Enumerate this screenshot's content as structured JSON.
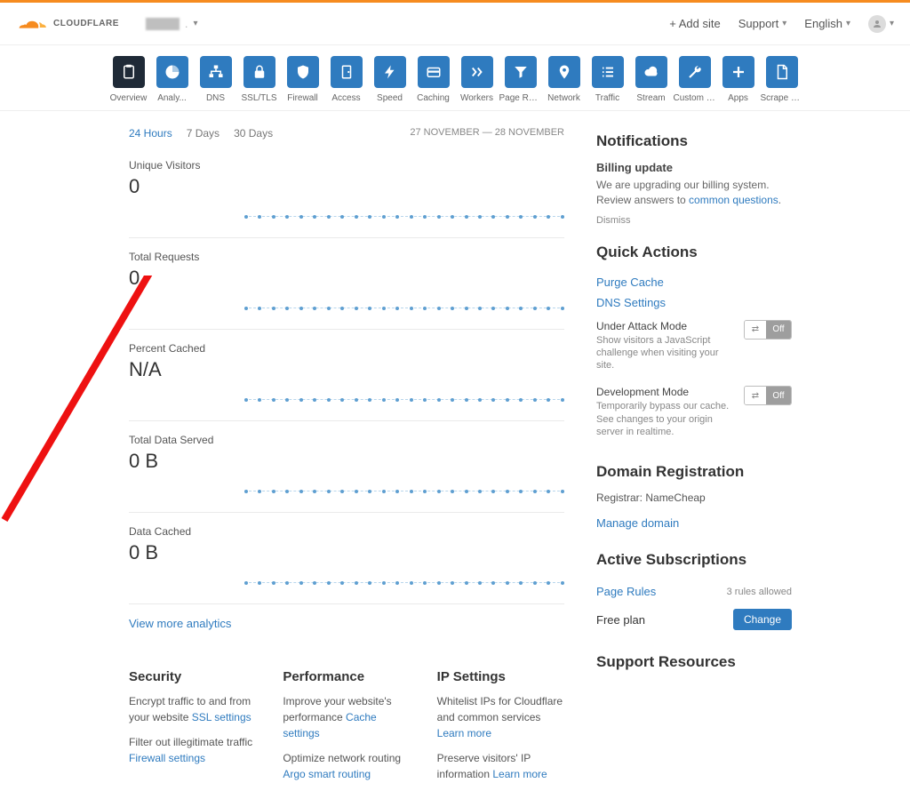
{
  "header": {
    "addSite": "+ Add site",
    "support": "Support",
    "language": "English"
  },
  "nav": [
    {
      "label": "Overview",
      "style": "dark",
      "icon": "clipboard"
    },
    {
      "label": "Analy...",
      "style": "blue",
      "icon": "pie"
    },
    {
      "label": "DNS",
      "style": "blue",
      "icon": "tree"
    },
    {
      "label": "SSL/TLS",
      "style": "blue",
      "icon": "lock"
    },
    {
      "label": "Firewall",
      "style": "blue",
      "icon": "shield"
    },
    {
      "label": "Access",
      "style": "blue",
      "icon": "door"
    },
    {
      "label": "Speed",
      "style": "blue",
      "icon": "bolt"
    },
    {
      "label": "Caching",
      "style": "blue",
      "icon": "card"
    },
    {
      "label": "Workers",
      "style": "blue",
      "icon": "chev"
    },
    {
      "label": "Page Rules",
      "style": "blue",
      "icon": "funnel"
    },
    {
      "label": "Network",
      "style": "blue",
      "icon": "pin"
    },
    {
      "label": "Traffic",
      "style": "blue",
      "icon": "list"
    },
    {
      "label": "Stream",
      "style": "blue",
      "icon": "cloud"
    },
    {
      "label": "Custom Pa...",
      "style": "blue",
      "icon": "wrench"
    },
    {
      "label": "Apps",
      "style": "blue",
      "icon": "plus"
    },
    {
      "label": "Scrape Shi...",
      "style": "blue",
      "icon": "file"
    }
  ],
  "tabs": [
    "24 Hours",
    "7 Days",
    "30 Days"
  ],
  "dateRange": "27 NOVEMBER — 28 NOVEMBER",
  "stats": [
    {
      "label": "Unique Visitors",
      "value": "0"
    },
    {
      "label": "Total Requests",
      "value": "0"
    },
    {
      "label": "Percent Cached",
      "value": "N/A"
    },
    {
      "label": "Total Data Served",
      "value": "0 B"
    },
    {
      "label": "Data Cached",
      "value": "0 B"
    }
  ],
  "viewMore": "View more analytics",
  "notifications": {
    "heading": "Notifications",
    "title": "Billing update",
    "body": "We are upgrading our billing system. Review answers to ",
    "link": "common questions",
    "dismiss": "Dismiss"
  },
  "quickActions": {
    "heading": "Quick Actions",
    "links": [
      "Purge Cache",
      "DNS Settings"
    ],
    "modes": [
      {
        "title": "Under Attack Mode",
        "desc": "Show visitors a JavaScript challenge when visiting your site.",
        "state": "Off"
      },
      {
        "title": "Development Mode",
        "desc": "Temporarily bypass our cache. See changes to your origin server in realtime.",
        "state": "Off"
      }
    ]
  },
  "domainReg": {
    "heading": "Domain Registration",
    "registrarLabel": "Registrar: NameCheap",
    "manage": "Manage domain"
  },
  "subs": {
    "heading": "Active Subscriptions",
    "pageRules": "Page Rules",
    "pageRulesMeta": "3 rules allowed",
    "freePlan": "Free plan",
    "change": "Change"
  },
  "supportRes": "Support Resources",
  "bottom": {
    "security": {
      "h": "Security",
      "p1a": "Encrypt traffic to and from your website ",
      "p1l": "SSL settings",
      "p2a": "Filter out illegitimate traffic ",
      "p2l": "Firewall settings"
    },
    "performance": {
      "h": "Performance",
      "p1a": "Improve your website's performance ",
      "p1l": "Cache settings",
      "p2a": "Optimize network routing ",
      "p2l": "Argo smart routing"
    },
    "ip": {
      "h": "IP Settings",
      "p1a": "Whitelist IPs for Cloudflare and common services ",
      "p1l": "Learn more",
      "p2a": "Preserve visitors' IP information ",
      "p2l": "Learn more"
    }
  }
}
